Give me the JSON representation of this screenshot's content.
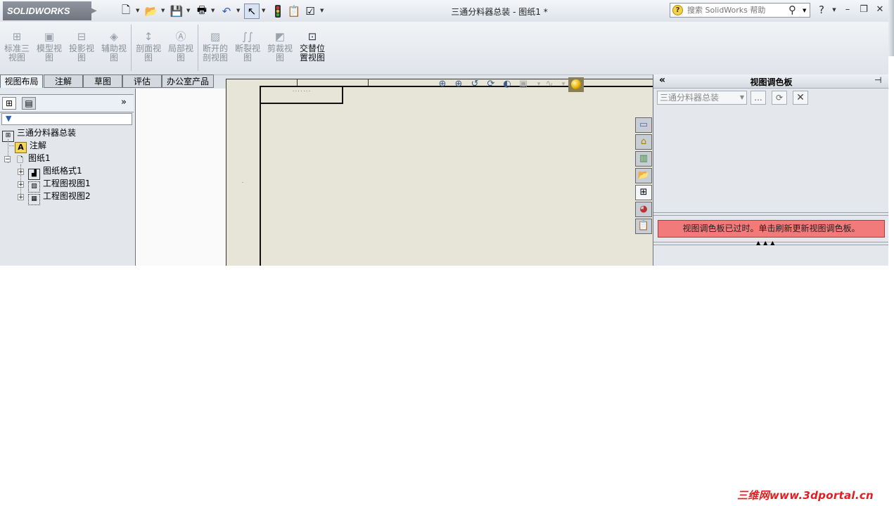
{
  "app": {
    "logo": "SOLIDWORKS",
    "title": "三通分料器总装 - 图纸1 *"
  },
  "help": {
    "placeholder": "搜索 SolidWorks 帮助"
  },
  "ribbon": {
    "buttons": [
      {
        "label": "标准三视图"
      },
      {
        "label": "模型视图"
      },
      {
        "label": "投影视图"
      },
      {
        "label": "辅助视图"
      },
      {
        "label": "剖面视图"
      },
      {
        "label": "局部视图"
      },
      {
        "label": "断开的剖视图"
      },
      {
        "label": "断裂视图"
      },
      {
        "label": "剪裁视图"
      },
      {
        "label": "交替位置视图"
      }
    ]
  },
  "tabs": [
    "视图布局",
    "注解",
    "草图",
    "评估",
    "办公室产品"
  ],
  "tree": {
    "root": "三通分料器总装",
    "annotations": "注解",
    "sheet": "图纸1",
    "children": [
      "图纸格式1",
      "工程图视图1",
      "工程图视图2"
    ]
  },
  "palette": {
    "title": "视图调色板",
    "combo_value": "三通分料器总装",
    "browse_label": "...",
    "warning": "视图调色板已过时。单击刷新更新视图调色板。"
  },
  "watermark": "三维网www.3dportal.cn"
}
